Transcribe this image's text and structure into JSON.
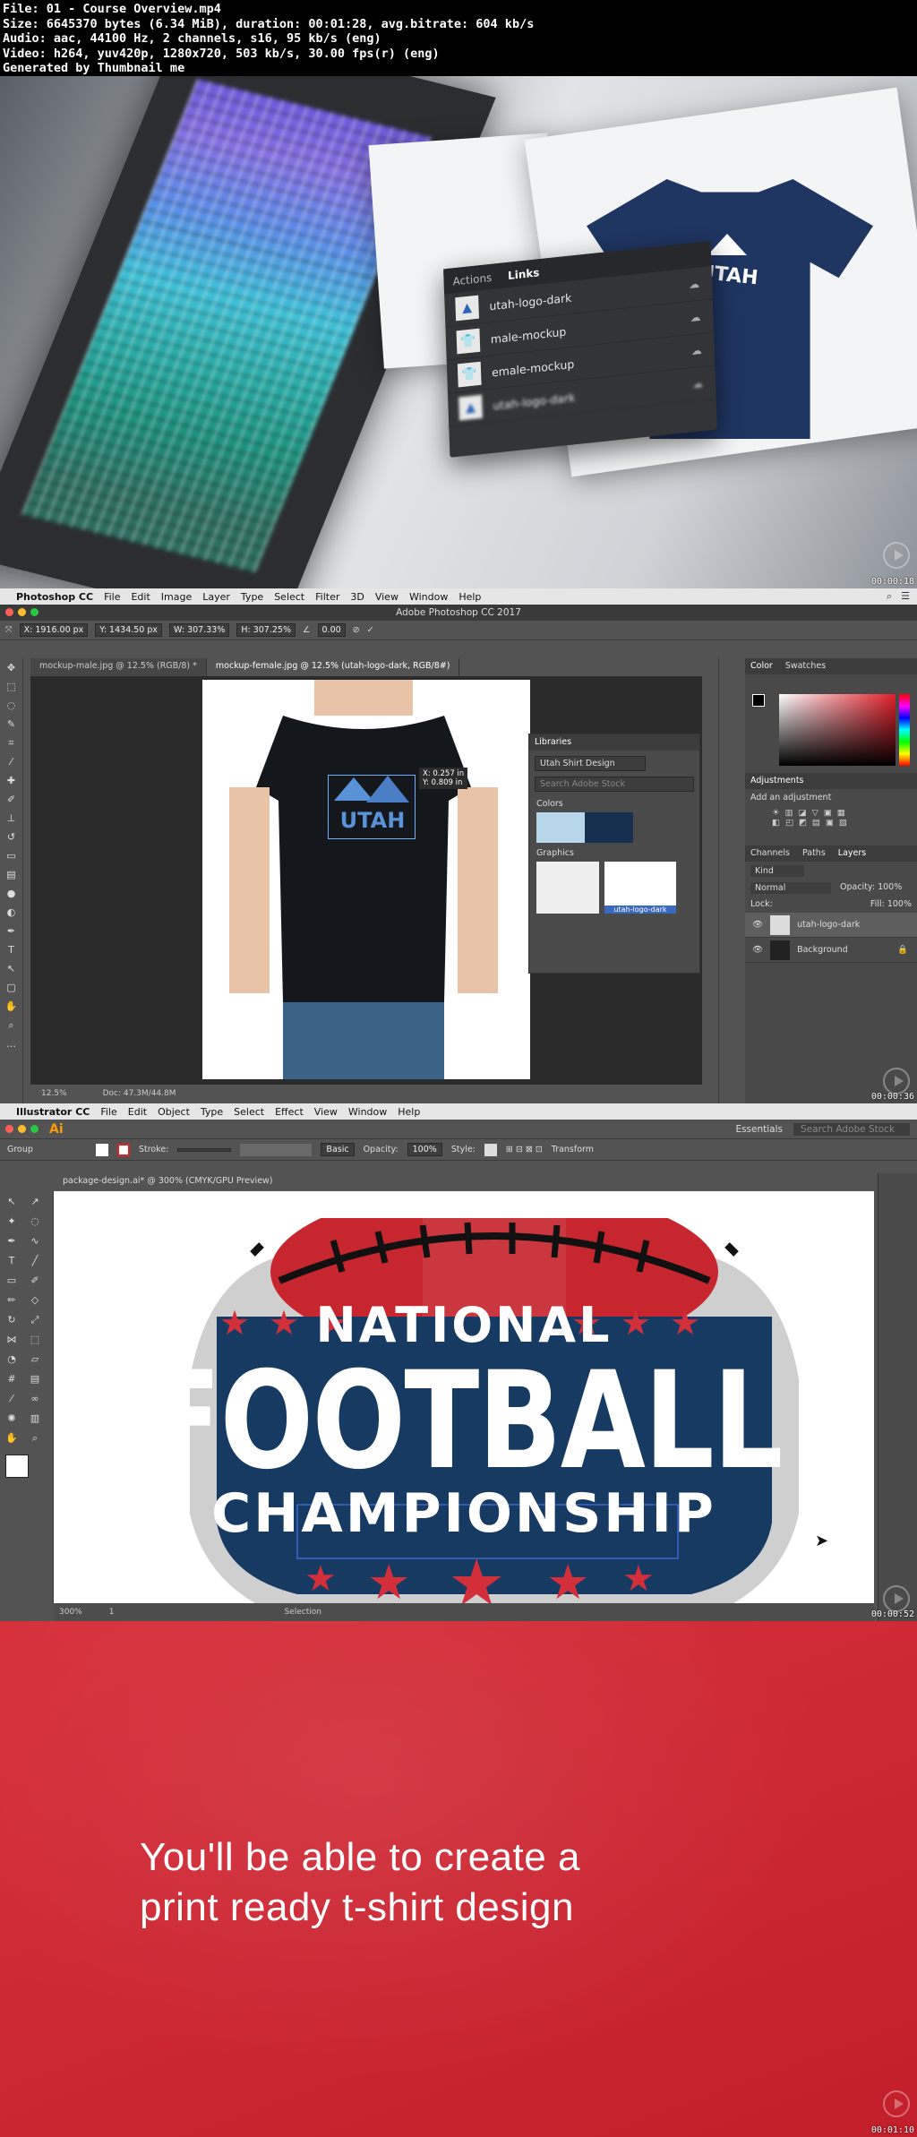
{
  "header": {
    "line1": "File: 01 - Course Overview.mp4",
    "line2": "Size: 6645370 bytes (6.34 MiB), duration: 00:01:28, avg.bitrate: 604 kb/s",
    "line3": "Audio: aac, 44100 Hz, 2 channels, s16, 95 kb/s (eng)",
    "line4": "Video: h264, yuv420p, 1280x720, 503 kb/s, 30.00 fps(r) (eng)",
    "line5": "Generated by Thumbnail me"
  },
  "frame1": {
    "timestamp": "00:00:18",
    "links_panel": {
      "tabs": [
        "Actions",
        "Links"
      ],
      "items": [
        "utah-logo-dark",
        "male-mockup",
        "emale-mockup",
        "utah-logo-dark"
      ]
    },
    "shirt_text": "UTAH"
  },
  "frame2": {
    "timestamp": "00:00:36",
    "menubar": {
      "app": "Photoshop CC",
      "items": [
        "File",
        "Edit",
        "Image",
        "Layer",
        "Type",
        "Select",
        "Filter",
        "3D",
        "View",
        "Window",
        "Help"
      ]
    },
    "window_title": "Adobe Photoshop CC 2017",
    "options": {
      "x": "X: 1916.00 px",
      "y": "Y: 1434.50 px",
      "w": "W: 307.33%",
      "h": "H: 307.25%",
      "angle": "0.00"
    },
    "doc_tabs": [
      "mockup-male.jpg @ 12.5% (RGB/8) *",
      "mockup-female.jpg @ 12.5% (utah-logo-dark, RGB/8#)"
    ],
    "transform_readout": {
      "x": "X: 0.257 in",
      "y": "Y: 0.809 in"
    },
    "shirt_text": "UTAH",
    "libraries": {
      "title": "Libraries",
      "library": "Utah Shirt Design",
      "search": "Search Adobe Stock",
      "colors_label": "Colors",
      "graphics_label": "Graphics",
      "graphic_caption": "utah-logo-dark",
      "colors": [
        "#b7d6ea",
        "#17304f"
      ]
    },
    "right_panels": {
      "color_tabs": [
        "Color",
        "Swatches"
      ],
      "adjustments_title": "Adjustments",
      "adjustments_sub": "Add an adjustment",
      "layer_tabs": [
        "Channels",
        "Paths",
        "Layers"
      ],
      "kind": "Kind",
      "blend": "Normal",
      "opacity": "Opacity: 100%",
      "lock": "Lock:",
      "fill": "Fill: 100%",
      "layers": [
        "utah-logo-dark",
        "Background"
      ]
    },
    "status": {
      "zoom": "12.5%",
      "doc": "Doc: 47.3M/44.8M"
    }
  },
  "frame3": {
    "timestamp": "00:00:52",
    "menubar": {
      "app": "Illustrator CC",
      "items": [
        "File",
        "Edit",
        "Object",
        "Type",
        "Select",
        "Effect",
        "View",
        "Window",
        "Help"
      ],
      "workspace": "Essentials",
      "search": "Search Adobe Stock"
    },
    "control": {
      "group": "Group",
      "stroke": "Stroke:",
      "basic": "Basic",
      "opacity_label": "Opacity:",
      "opacity": "100%",
      "style": "Style:",
      "transform": "Transform"
    },
    "doc_tab": "package-design.ai* @ 300% (CMYK/GPU Preview)",
    "badge": {
      "line1": "NATIONAL",
      "line2": "FOOTBALL",
      "line3": "CHAMPIONSHIP"
    },
    "status": {
      "zoom": "300%",
      "page": "1",
      "tool": "Selection"
    },
    "colors": {
      "navy": "#173a63",
      "red": "#d32f3a",
      "gray": "#cfcfcf"
    }
  },
  "frame4": {
    "timestamp": "00:01:10",
    "caption_line1": "You'll be able to create a",
    "caption_line2": "print ready t-shirt design"
  }
}
